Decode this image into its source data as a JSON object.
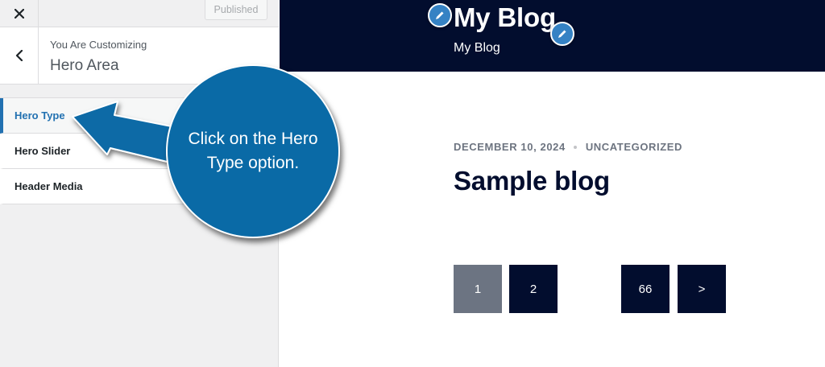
{
  "customizer": {
    "close_icon": "close-icon",
    "publish_label": "Published",
    "back_icon": "chevron-left-icon",
    "customizing_label": "You Are Customizing",
    "section_title": "Hero Area",
    "menu_items": [
      {
        "label": "Hero Type",
        "active": true
      },
      {
        "label": "Hero Slider",
        "active": false
      },
      {
        "label": "Header Media",
        "active": false
      }
    ]
  },
  "preview": {
    "site_title": "My Blog",
    "site_tagline": "My Blog",
    "edit_icon": "pencil-icon",
    "post": {
      "date": "DECEMBER 10, 2024",
      "category": "UNCATEGORIZED",
      "title": "Sample blog"
    },
    "pagination": [
      {
        "label": "1",
        "current": true
      },
      {
        "label": "2",
        "current": false
      },
      {
        "label": "66",
        "current": false
      },
      {
        "label": ">",
        "current": false
      }
    ]
  },
  "annotation": {
    "text": "Click on the Hero Type option."
  },
  "colors": {
    "header_bg": "#020d2e",
    "accent": "#2271b1",
    "callout_bg": "#0a6aa6",
    "current_page": "#6c7482"
  }
}
